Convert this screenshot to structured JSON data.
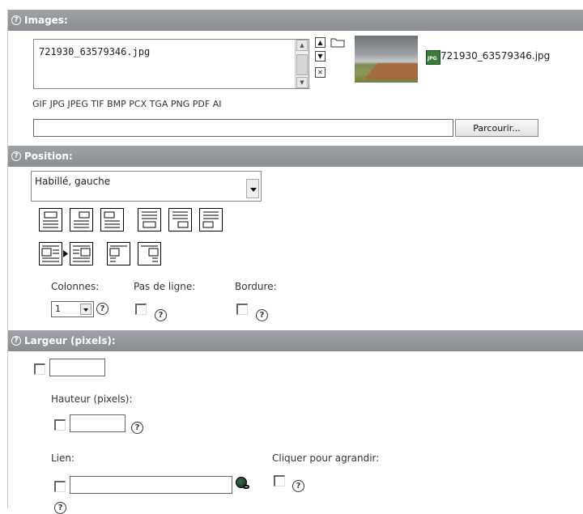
{
  "images": {
    "header": "Images:",
    "filename": "721930_63579346.jpg",
    "preview_filename": "721930_63579346.jpg",
    "file_type_badge": "JPG",
    "allowed_types": "GIF JPG JPEG TIF BMP PCX TGA PNG PDF AI",
    "file_input_value": "",
    "browse_label": "Parcourir...",
    "controls": {
      "up": "▲",
      "down": "▼",
      "delete": "✕"
    }
  },
  "position": {
    "header": "Position:",
    "select_value": "Habillé, gauche",
    "columns_label": "Colonnes:",
    "columns_value": "1",
    "no_rows_label": "Pas de ligne:",
    "border_label": "Bordure:"
  },
  "width": {
    "header": "Largeur (pixels):",
    "width_value": "",
    "height_label": "Hauteur (pixels):",
    "height_value": "",
    "link_label": "Lien:",
    "link_value": "",
    "enlarge_label": "Cliquer pour agrandir:"
  },
  "help_glyph": "?",
  "colors": {
    "header_bar": "#949899",
    "header_text": "#ffffff"
  },
  "icons": [
    "help-icon",
    "folder-icon",
    "jpg-file-icon",
    "link-browser-icon"
  ]
}
